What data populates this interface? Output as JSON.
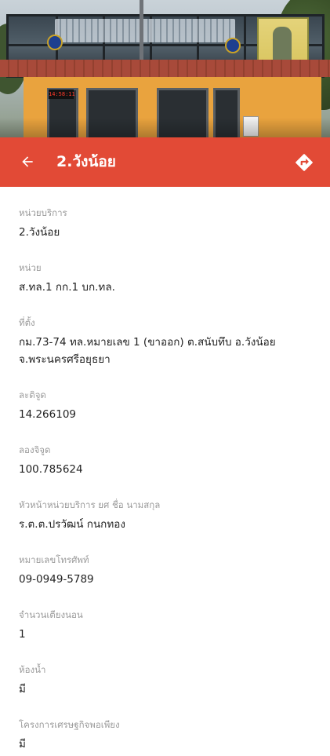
{
  "header": {
    "title": "2.วังน้อย",
    "back_icon": "arrow-left-icon",
    "directions_icon": "directions-icon",
    "bar_color": "#e24a36"
  },
  "photo": {
    "clock_text": "14:58:11"
  },
  "details": [
    {
      "label": "หน่วยบริการ",
      "value": "2.วังน้อย"
    },
    {
      "label": "หน่วย",
      "value": "ส.ทล.1 กก.1 บก.ทล."
    },
    {
      "label": "ที่ตั้ง",
      "value": "กม.73-74 ทล.หมายเลข 1 (ขาออก) ต.สนับทึบ อ.วังน้อย จ.พระนครศรีอยุธยา"
    },
    {
      "label": "ละติจูด",
      "value": "14.266109"
    },
    {
      "label": "ลองจิจูด",
      "value": "100.785624"
    },
    {
      "label": "หัวหน้าหน่วยบริการ ยศ ชื่อ นามสกุล",
      "value": "ร.ต.ต.ปรวัฒน์ กนกทอง"
    },
    {
      "label": "หมายเลขโทรศัพท์",
      "value": "09-0949-5789"
    },
    {
      "label": "จำนวนเตียงนอน",
      "value": "1"
    },
    {
      "label": "ห้องน้ำ",
      "value": "มี"
    },
    {
      "label": "โครงการเศรษฐกิจพอเพียง",
      "value": "มี"
    }
  ]
}
